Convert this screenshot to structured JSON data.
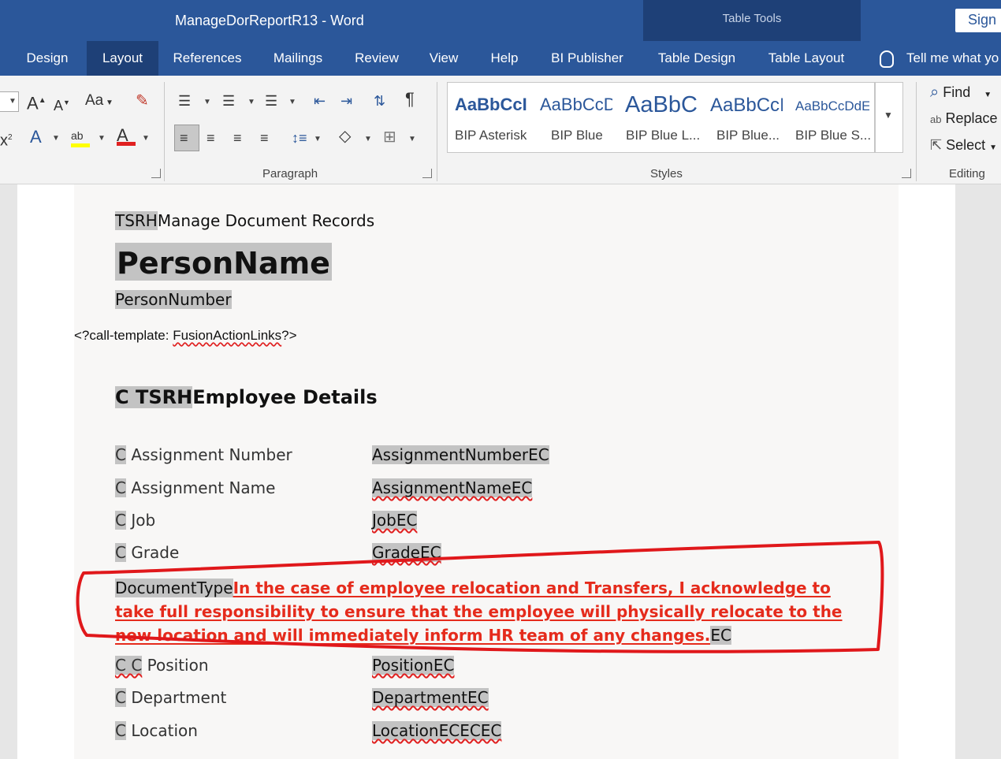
{
  "window": {
    "title": "ManageDorReportR13  -  Word",
    "context_label": "Table Tools",
    "sign_in": "Sign i"
  },
  "tabs": [
    {
      "label": "Design"
    },
    {
      "label": "Layout",
      "active": true
    },
    {
      "label": "References"
    },
    {
      "label": "Mailings"
    },
    {
      "label": "Review"
    },
    {
      "label": "View"
    },
    {
      "label": "Help"
    },
    {
      "label": "BI Publisher"
    },
    {
      "label": "Table Design"
    },
    {
      "label": "Table Layout"
    }
  ],
  "tell_me": "Tell me what yo",
  "ribbon": {
    "paragraph_label": "Paragraph",
    "styles_label": "Styles",
    "editing_label": "Editing",
    "styles": [
      {
        "sample": "AaBbCcI",
        "name": "BIP Asterisk"
      },
      {
        "sample": "AaBbCcD",
        "name": "BIP Blue"
      },
      {
        "sample": "AaBbC",
        "name": "BIP Blue L..."
      },
      {
        "sample": "AaBbCcI",
        "name": "BIP Blue..."
      },
      {
        "sample": "AaBbCcDdE",
        "name": "BIP Blue S..."
      }
    ],
    "editing": {
      "find": "Find",
      "replace": "Replace",
      "select": "Select"
    },
    "font_size_grow": "A",
    "font_size_shrink": "A",
    "change_case": "Aa",
    "superscript": "x"
  },
  "document": {
    "tsrh_prefix": "TSRH",
    "heading_text": "Manage Document Records",
    "person_name": "PersonName",
    "person_number": "PersonNumber",
    "call_template_prefix": "<?call-template: ",
    "call_template_name": "FusionActionLinks",
    "call_template_suffix": "?>",
    "section_prefix": "C TSRH",
    "section_title": "Employee Details",
    "rows": [
      {
        "c": "C",
        "label": "Assignment Number",
        "value": "AssignmentNumberEC"
      },
      {
        "c": "C",
        "label": "Assignment Name",
        "value": "AssignmentNameEC"
      },
      {
        "c": "C",
        "label": "Job",
        "value": "JobEC"
      },
      {
        "c": "C",
        "label": "Grade",
        "value": "GradeEC"
      }
    ],
    "doc_type_label": "DocumentType",
    "doc_type_text": "In the case of employee relocation and Transfers, I acknowledge to take full responsibility to ensure that the employee will physically relocate to the new location and will immediately inform HR team of any changes.",
    "doc_type_suffix": "EC",
    "rows_after": [
      {
        "c": "C C",
        "label": "Position",
        "value": "PositionEC"
      },
      {
        "c": "C",
        "label": "Department",
        "value": "DepartmentEC"
      },
      {
        "c": "C",
        "label": "Location",
        "value": "LocationECECEC"
      }
    ]
  },
  "colors": {
    "ribbon_blue": "#2b579a",
    "context_blue": "#1e4077",
    "annotation_red": "#e0181b",
    "field_highlight": "#c3c3c3"
  }
}
